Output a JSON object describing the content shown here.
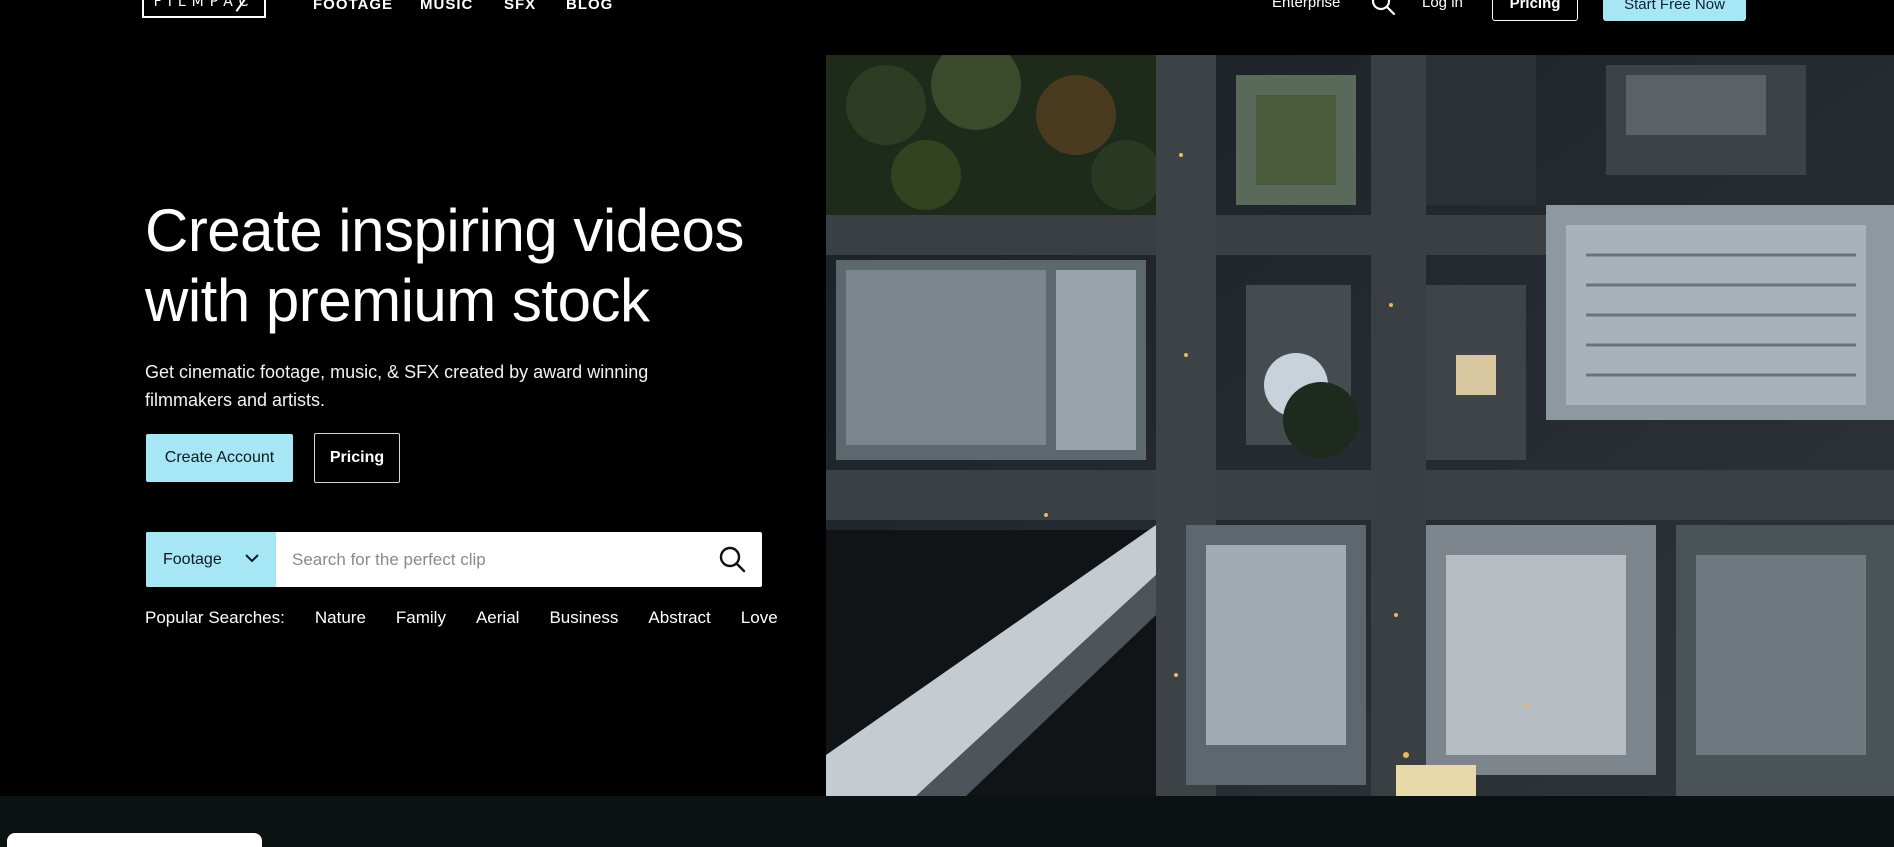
{
  "nav": {
    "logo_text": "FILMPAC",
    "links": [
      {
        "label": "FOOTAGE"
      },
      {
        "label": "MUSIC"
      },
      {
        "label": "SFX"
      },
      {
        "label": "BLOG"
      }
    ],
    "enterprise": "Enterprise",
    "login": "Log in",
    "pricing": "Pricing",
    "start_free": "Start Free Now"
  },
  "hero": {
    "title_line1": "Create inspiring videos",
    "title_line2": "with premium stock",
    "subtitle_line1": "Get cinematic footage, music, & SFX created by award winning",
    "subtitle_line2": "filmmakers and artists.",
    "create_account": "Create Account",
    "pricing": "Pricing"
  },
  "search": {
    "category": "Footage",
    "placeholder": "Search for the perfect clip"
  },
  "popular": {
    "label": "Popular Searches:",
    "items": [
      "Nature",
      "Family",
      "Aerial",
      "Business",
      "Abstract",
      "Love"
    ]
  },
  "colors": {
    "accent": "#a7e6f4",
    "background": "#000000",
    "bottom_band": "#0b1212"
  }
}
